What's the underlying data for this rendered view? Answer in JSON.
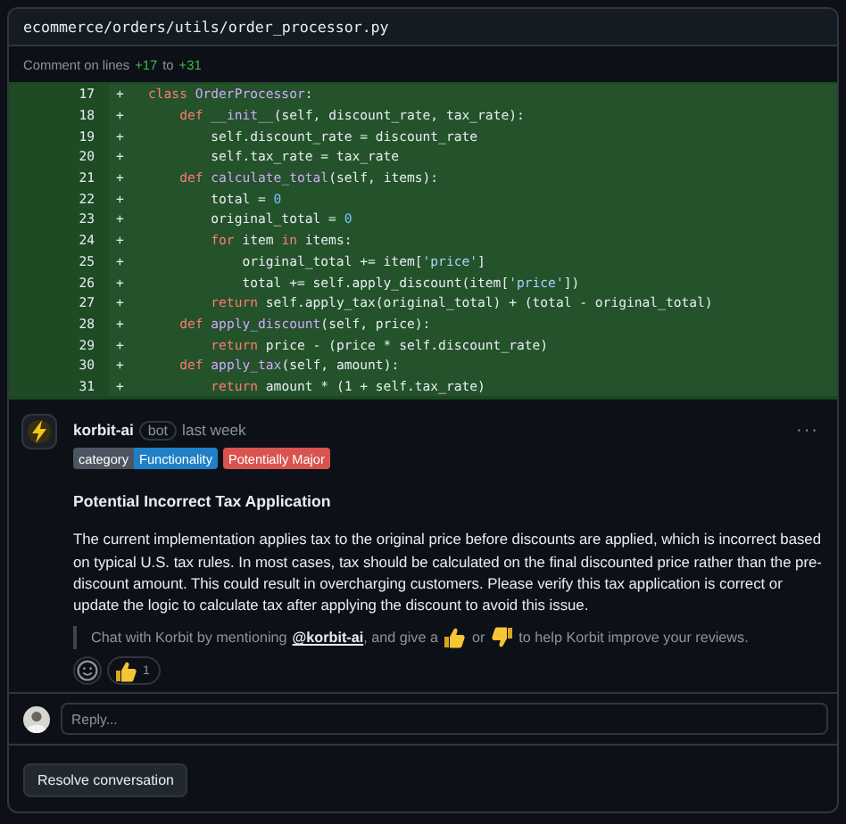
{
  "file": {
    "path": "ecommerce/orders/utils/order_processor.py"
  },
  "range": {
    "prefix": "Comment on lines",
    "start": "+17",
    "joiner": "to",
    "end": "+31"
  },
  "code_lines": [
    {
      "number": "17",
      "sign": "+",
      "tokens": [
        {
          "kind": "keyword",
          "text": "class"
        },
        {
          "kind": "name",
          "text": " OrderProcessor"
        },
        {
          "kind": "plain",
          "text": ":"
        }
      ]
    },
    {
      "number": "18",
      "sign": "+",
      "tokens": [
        {
          "kind": "keyword",
          "text": "    def"
        },
        {
          "kind": "name",
          "text": " __init__"
        },
        {
          "kind": "plain",
          "text": "(self, discount_rate, tax_rate):"
        }
      ]
    },
    {
      "number": "19",
      "sign": "+",
      "tokens": [
        {
          "kind": "plain",
          "text": "        self.discount_rate = discount_rate"
        }
      ]
    },
    {
      "number": "20",
      "sign": "+",
      "tokens": [
        {
          "kind": "plain",
          "text": "        self.tax_rate = tax_rate"
        }
      ]
    },
    {
      "number": "21",
      "sign": "+",
      "tokens": [
        {
          "kind": "keyword",
          "text": "    def"
        },
        {
          "kind": "name",
          "text": " calculate_total"
        },
        {
          "kind": "plain",
          "text": "(self, items):"
        }
      ]
    },
    {
      "number": "22",
      "sign": "+",
      "tokens": [
        {
          "kind": "plain",
          "text": "        total = "
        },
        {
          "kind": "number",
          "text": "0"
        }
      ]
    },
    {
      "number": "23",
      "sign": "+",
      "tokens": [
        {
          "kind": "plain",
          "text": "        original_total = "
        },
        {
          "kind": "number",
          "text": "0"
        }
      ]
    },
    {
      "number": "24",
      "sign": "+",
      "tokens": [
        {
          "kind": "keyword",
          "text": "        for"
        },
        {
          "kind": "plain",
          "text": " item "
        },
        {
          "kind": "keyword",
          "text": "in"
        },
        {
          "kind": "plain",
          "text": " items:"
        }
      ]
    },
    {
      "number": "25",
      "sign": "+",
      "tokens": [
        {
          "kind": "plain",
          "text": "            original_total += item["
        },
        {
          "kind": "string",
          "text": "'price'"
        },
        {
          "kind": "plain",
          "text": "]"
        }
      ]
    },
    {
      "number": "26",
      "sign": "+",
      "tokens": [
        {
          "kind": "plain",
          "text": "            total += self.apply_discount(item["
        },
        {
          "kind": "string",
          "text": "'price'"
        },
        {
          "kind": "plain",
          "text": "])"
        }
      ]
    },
    {
      "number": "27",
      "sign": "+",
      "tokens": [
        {
          "kind": "keyword",
          "text": "        return"
        },
        {
          "kind": "plain",
          "text": " self.apply_tax(original_total) + (total - original_total)"
        }
      ]
    },
    {
      "number": "28",
      "sign": "+",
      "tokens": [
        {
          "kind": "keyword",
          "text": "    def"
        },
        {
          "kind": "name",
          "text": " apply_discount"
        },
        {
          "kind": "plain",
          "text": "(self, price):"
        }
      ]
    },
    {
      "number": "29",
      "sign": "+",
      "tokens": [
        {
          "kind": "keyword",
          "text": "        return"
        },
        {
          "kind": "plain",
          "text": " price - (price * self.discount_rate)"
        }
      ]
    },
    {
      "number": "30",
      "sign": "+",
      "tokens": [
        {
          "kind": "keyword",
          "text": "    def"
        },
        {
          "kind": "name",
          "text": " apply_tax"
        },
        {
          "kind": "plain",
          "text": "(self, amount):"
        }
      ]
    },
    {
      "number": "31",
      "sign": "+",
      "tokens": [
        {
          "kind": "keyword",
          "text": "        return"
        },
        {
          "kind": "plain",
          "text": " amount * (1 + self.tax_rate)"
        }
      ]
    }
  ],
  "comment": {
    "author": "korbit-ai",
    "badge": "bot",
    "time": "last week",
    "more": "···",
    "labels": [
      {
        "kind": "scope",
        "text": "category",
        "color": "#4d5561"
      },
      {
        "kind": "scope-value",
        "text": "Functionality",
        "color": "#1f7fc7"
      },
      {
        "kind": "tag",
        "text": "Potentially Major",
        "color": "#d9534f"
      }
    ],
    "title": "Potential Incorrect Tax Application",
    "body": "The current implementation applies tax to the original price before discounts are applied, which is incorrect based on typical U.S. tax rules. In most cases, tax should be calculated on the final discounted price rather than the pre-discount amount. This could result in overcharging customers. Please verify this tax application is correct or update the logic to calculate tax after applying the discount to avoid this issue.",
    "note": {
      "before": "Chat with Korbit by mentioning",
      "mention": "@korbit-ai",
      "middle": ", and give a",
      "or": "or",
      "after": "to help Korbit improve your reviews."
    },
    "reactions": [
      {
        "count": "1",
        "selected": false
      }
    ]
  },
  "reply": {
    "placeholder": "Reply..."
  },
  "resolve_button": "Resolve conversation"
}
